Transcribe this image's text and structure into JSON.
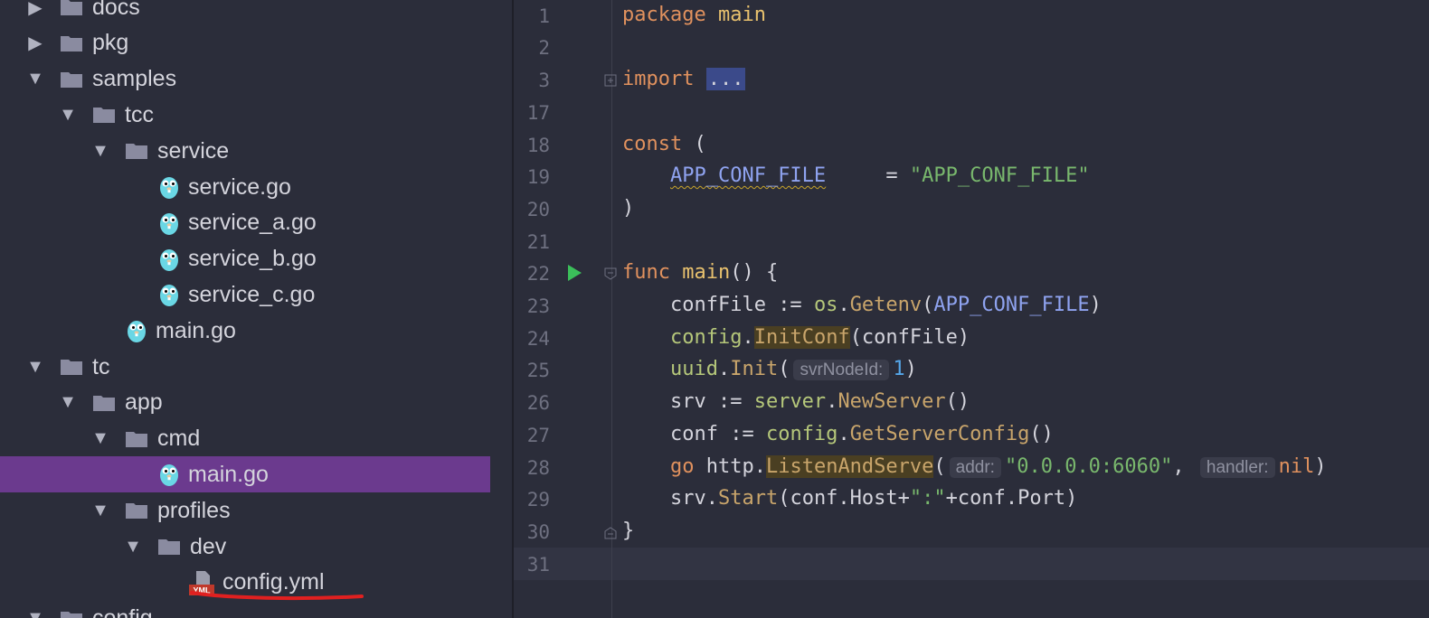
{
  "tree": {
    "items": [
      {
        "label": "docs",
        "kind": "folder",
        "expanded": false,
        "depth": 0
      },
      {
        "label": "pkg",
        "kind": "folder",
        "expanded": false,
        "depth": 0
      },
      {
        "label": "samples",
        "kind": "folder",
        "expanded": true,
        "depth": 0
      },
      {
        "label": "tcc",
        "kind": "folder",
        "expanded": true,
        "depth": 1
      },
      {
        "label": "service",
        "kind": "folder",
        "expanded": true,
        "depth": 2
      },
      {
        "label": "service.go",
        "kind": "go",
        "depth": 3
      },
      {
        "label": "service_a.go",
        "kind": "go",
        "depth": 3
      },
      {
        "label": "service_b.go",
        "kind": "go",
        "depth": 3
      },
      {
        "label": "service_c.go",
        "kind": "go",
        "depth": 3
      },
      {
        "label": "main.go",
        "kind": "go",
        "depth": 2
      },
      {
        "label": "tc",
        "kind": "folder",
        "expanded": true,
        "depth": 0
      },
      {
        "label": "app",
        "kind": "folder",
        "expanded": true,
        "depth": 1
      },
      {
        "label": "cmd",
        "kind": "folder",
        "expanded": true,
        "depth": 2
      },
      {
        "label": "main.go",
        "kind": "go",
        "depth": 3,
        "selected": true
      },
      {
        "label": "profiles",
        "kind": "folder",
        "expanded": true,
        "depth": 2
      },
      {
        "label": "dev",
        "kind": "folder",
        "expanded": true,
        "depth": 3
      },
      {
        "label": "config.yml",
        "kind": "yml",
        "depth": 4
      },
      {
        "label": "config",
        "kind": "folder",
        "expanded": true,
        "depth": 0
      }
    ],
    "yml_badge": "YML"
  },
  "editor": {
    "line_numbers": [
      "1",
      "2",
      "3",
      "17",
      "18",
      "19",
      "20",
      "21",
      "22",
      "23",
      "24",
      "25",
      "26",
      "27",
      "28",
      "29",
      "30",
      "31"
    ],
    "code": {
      "l1_kw": "package",
      "l1_name": "main",
      "l3_kw": "import",
      "l3_fold": "...",
      "l18_kw": "const",
      "l18_paren": "(",
      "l19_const": "APP_CONF_FILE",
      "l19_eq": "     = ",
      "l19_str": "\"APP_CONF_FILE\"",
      "l20": ")",
      "l22_kw": "func",
      "l22_fn": "main",
      "l22_rest": "() {",
      "l23_a": "confFile := ",
      "l23_pkg": "os",
      "l23_dot": ".",
      "l23_m": "Getenv",
      "l23_p1": "(",
      "l23_const": "APP_CONF_FILE",
      "l23_p2": ")",
      "l24_pkg": "config",
      "l24_dot": ".",
      "l24_m": "InitConf",
      "l24_rest": "(confFile)",
      "l25_pkg": "uuid",
      "l25_dot": ".",
      "l25_m": "Init",
      "l25_p1": "(",
      "l25_hint": "svrNodeId:",
      "l25_num": "1",
      "l25_p2": ")",
      "l26_a": "srv := ",
      "l26_pkg": "server",
      "l26_dot": ".",
      "l26_m": "NewServer",
      "l26_rest": "()",
      "l27_a": "conf := ",
      "l27_pkg": "config",
      "l27_dot": ".",
      "l27_m": "GetServerConfig",
      "l27_rest": "()",
      "l28_kw": "go",
      "l28_pkg": " http",
      "l28_dot": ".",
      "l28_m": "ListenAndServe",
      "l28_p1": "(",
      "l28_hint1": "addr:",
      "l28_str": "\"0.0.0.0:6060\"",
      "l28_comma": ", ",
      "l28_hint2": "handler:",
      "l28_nil": "nil",
      "l28_p2": ")",
      "l29_a": "srv.",
      "l29_m": "Start",
      "l29_b": "(conf.Host+",
      "l29_str": "\":\"",
      "l29_c": "+conf.Port)",
      "l30": "}"
    }
  }
}
